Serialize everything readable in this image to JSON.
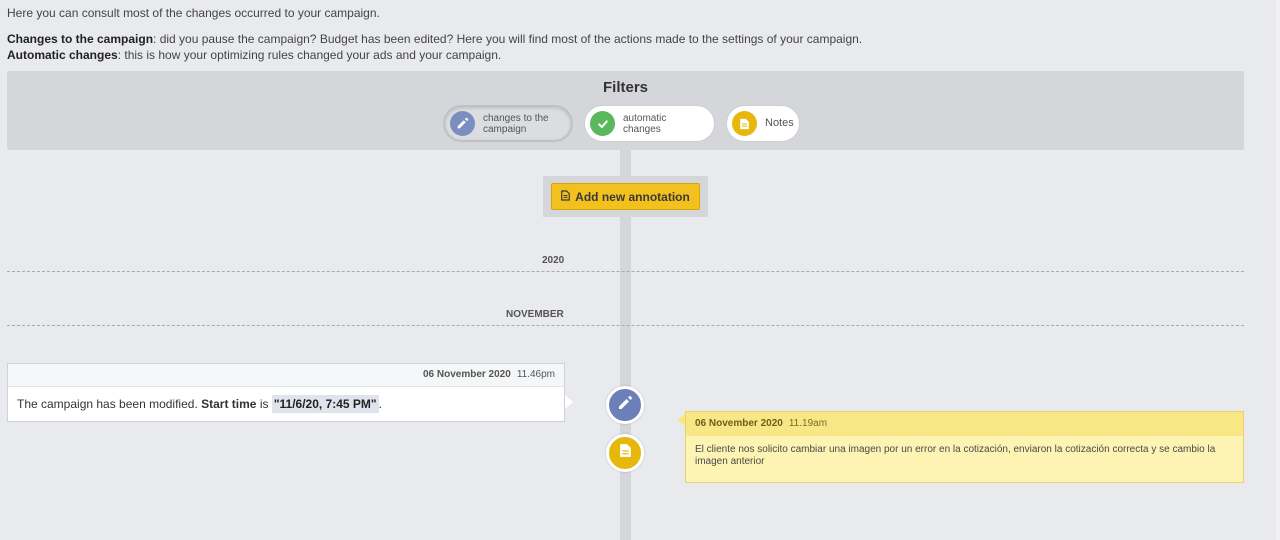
{
  "intro": "Here you can consult most of the changes occurred to your campaign.",
  "descriptions": [
    {
      "title": "Changes to the campaign",
      "text": ": did you pause the campaign? Budget has been edited? Here you will find most of the actions made to the settings of your campaign."
    },
    {
      "title": "Automatic changes",
      "text": ": this is how your optimizing rules changed your ads and your campaign."
    }
  ],
  "filters": {
    "title": "Filters",
    "pills": [
      {
        "label": "changes to the campaign",
        "line1": "changes to the",
        "line2": "campaign",
        "icon": "pencil-icon",
        "color": "#7b8ec0",
        "active": true
      },
      {
        "label": "automatic changes",
        "line1": "automatic",
        "line2": "changes",
        "icon": "check-icon",
        "color": "#5cb85c",
        "active": false
      },
      {
        "label": "Notes",
        "line1": "Notes",
        "line2": "",
        "icon": "note-icon",
        "color": "#e6b80c",
        "active": false
      }
    ]
  },
  "annotation_button": "Add new annotation",
  "year": "2020",
  "month": "NOVEMBER",
  "events": {
    "left": {
      "date": "06 November 2020",
      "time": "11.46pm",
      "text_before": "The campaign has been modified. ",
      "field": "Start time",
      "text_mid": " is ",
      "value": "\"11/6/20, 7:45 PM\"",
      "text_after": ".",
      "icon": "pencil-icon"
    },
    "right": {
      "date": "06 November 2020",
      "time": "11.19am",
      "text": "El cliente nos solicito cambiar una imagen por un error en la cotización, enviaron la cotización correcta y se cambio la imagen anterior",
      "icon": "note-icon"
    }
  },
  "colors": {
    "accent": "#f2c11e",
    "edit": "#6c7fb8",
    "auto": "#5cb85c",
    "note": "#e6b80c"
  }
}
